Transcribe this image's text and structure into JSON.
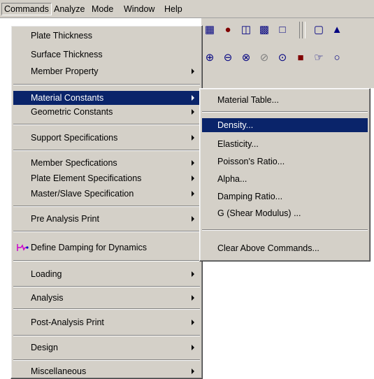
{
  "menubar": {
    "items": [
      "Commands",
      "Analyze",
      "Mode",
      "Window",
      "Help"
    ]
  },
  "toolbar": {
    "row1_icons": [
      "calculator-icon",
      "camera-icon",
      "export-icon",
      "print-icon",
      "print-preview-icon",
      "window-icon",
      "pen-icon"
    ],
    "row2_icons": [
      "zoom-in-icon",
      "zoom-out-icon",
      "zoom-window-icon",
      "zoom-dynamic-icon",
      "zoom-extent-icon",
      "edit-icon",
      "pan-icon",
      "rotate-icon"
    ]
  },
  "commands_menu": {
    "items": [
      {
        "label": "Plate Thickness"
      },
      {
        "label": "Surface Thickness"
      },
      {
        "label": "Member Property"
      },
      {
        "label": "Material Constants"
      },
      {
        "label": "Geometric Constants"
      },
      {
        "label": "Support Specifications"
      },
      {
        "label": "Member Specfications"
      },
      {
        "label": "Plate Element Specifications"
      },
      {
        "label": "Master/Slave Specification"
      },
      {
        "label": "Pre Analysis Print"
      },
      {
        "label": "Define Damping for Dynamics"
      },
      {
        "label": "Loading"
      },
      {
        "label": "Analysis"
      },
      {
        "label": "Post-Analysis Print"
      },
      {
        "label": "Design"
      },
      {
        "label": "Miscellaneous"
      }
    ]
  },
  "material_submenu": {
    "items": [
      {
        "label": "Material Table..."
      },
      {
        "label": "Density..."
      },
      {
        "label": "Elasticity..."
      },
      {
        "label": "Poisson's Ratio..."
      },
      {
        "label": "Alpha..."
      },
      {
        "label": "Damping Ratio..."
      },
      {
        "label": "G (Shear Modulus) ..."
      },
      {
        "label": "Clear Above Commands..."
      }
    ]
  },
  "colors": {
    "highlight": "#0a246a",
    "menu_bg": "#d4d0c8",
    "damping_icon": "#cc00cc"
  }
}
